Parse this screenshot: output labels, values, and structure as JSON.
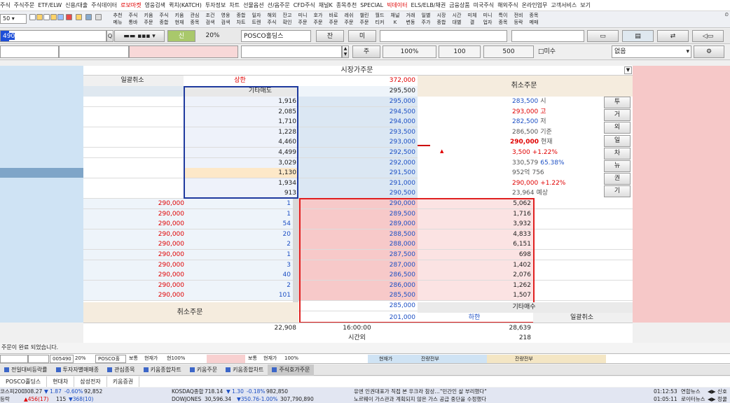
{
  "menu": [
    "주식",
    "주식주문",
    "ETF/ELW",
    "신용/대출",
    "주식데이터",
    "로보마켓",
    "영웅검색",
    "퀵치(KATCH)",
    "투자정보",
    "차트",
    "선물옵션",
    "선/옵주문",
    "CFD주식",
    "채널K",
    "종목추천",
    "SPECIAL",
    "빅데이터",
    "ELS/ELB/채권",
    "금융상품",
    "미국주식",
    "해외주식",
    "온라인업무",
    "고객서비스",
    "보기"
  ],
  "toolbar": [
    {
      "t1": "추천",
      "t2": "메뉴"
    },
    {
      "t1": "주식",
      "t2": "통바"
    },
    {
      "t1": "키움",
      "t2": "주문"
    },
    {
      "t1": "주식",
      "t2": "종합"
    },
    {
      "t1": "키움",
      "t2": "현재"
    },
    {
      "t1": "관심",
      "t2": "종목"
    },
    {
      "t1": "조건",
      "t2": "검색"
    },
    {
      "t1": "영웅",
      "t2": "검색"
    },
    {
      "t1": "종합",
      "t2": "차트"
    },
    {
      "t1": "일자",
      "t2": "트렌"
    },
    {
      "t1": "해외",
      "t2": "주식"
    },
    {
      "t1": "잔고",
      "t2": "확인"
    },
    {
      "t1": "미니",
      "t2": "주문"
    },
    {
      "t1": "호가",
      "t2": "주문"
    },
    {
      "t1": "바로",
      "t2": "주문"
    },
    {
      "t1": "레쉬",
      "t2": "주문"
    },
    {
      "t1": "챌린",
      "t2": "주문"
    },
    {
      "t1": "월드",
      "t2": "티커"
    },
    {
      "t1": "채널",
      "t2": "K"
    },
    {
      "t1": "거래",
      "t2": "변동"
    },
    {
      "t1": "일별",
      "t2": "주가"
    },
    {
      "t1": "시장",
      "t2": "종합"
    },
    {
      "t1": "시간",
      "t2": "대별"
    },
    {
      "t1": "미체",
      "t2": "결"
    },
    {
      "t1": "미니",
      "t2": "업자"
    },
    {
      "t1": "특이",
      "t2": "종목"
    },
    {
      "t1": "전비",
      "t2": "등락"
    },
    {
      "t1": "종목",
      "t2": "메매"
    }
  ],
  "order": {
    "code": "490",
    "credit_label": "신",
    "pct": "20%",
    "stock_name": "POSCO홀딩스",
    "jan_btn": "잔",
    "mi_btn": "미",
    "ju_btn": "주",
    "pct100": "100%",
    "qty100": "100",
    "qty500": "500",
    "misu_label": "□미수",
    "none_select": "없음"
  },
  "header": {
    "market_order": "시장가주문",
    "cancel_all": "일괄취소",
    "upper_limit_label": "상한",
    "upper_limit_price": "372,000",
    "other_sell": "기타매도",
    "other_sell_qty": "295,500",
    "cancel_order": "취소주문",
    "other_buy": "기타매수",
    "lower_limit_label": "하한",
    "lower_limit_price": "201,000",
    "cancel_order2": "취소주문",
    "cancel_all2": "일괄취소",
    "total_sell": "22,908",
    "time": "16:00:00",
    "total_buy": "28,639",
    "after_hours": "시간외",
    "after_hours_qty": "218"
  },
  "asks": [
    {
      "qty": "1,916",
      "price": "295,000"
    },
    {
      "qty": "2,085",
      "price": "294,500"
    },
    {
      "qty": "1,710",
      "price": "294,000"
    },
    {
      "qty": "1,228",
      "price": "293,500"
    },
    {
      "qty": "4,460",
      "price": "293,000"
    },
    {
      "qty": "4,499",
      "price": "292,500"
    },
    {
      "qty": "3,029",
      "price": "292,000"
    },
    {
      "qty": "1,130",
      "price": "291,500"
    },
    {
      "qty": "1,934",
      "price": "291,000"
    },
    {
      "qty": "913",
      "price": "290,500"
    }
  ],
  "bids": [
    {
      "price": "290,000",
      "qty": "5,062"
    },
    {
      "price": "289,500",
      "qty": "1,716"
    },
    {
      "price": "289,000",
      "qty": "3,932"
    },
    {
      "price": "288,500",
      "qty": "4,833"
    },
    {
      "price": "288,000",
      "qty": "6,151"
    },
    {
      "price": "287,500",
      "qty": "698"
    },
    {
      "price": "287,000",
      "qty": "1,402"
    },
    {
      "price": "286,500",
      "qty": "2,076"
    },
    {
      "price": "286,000",
      "qty": "1,262"
    },
    {
      "price": "285,500",
      "qty": "1,507"
    },
    {
      "price": "285,000",
      "qty": ""
    }
  ],
  "trades": [
    {
      "price": "290,000",
      "qty": "1"
    },
    {
      "price": "290,000",
      "qty": "1"
    },
    {
      "price": "290,000",
      "qty": "54"
    },
    {
      "price": "290,000",
      "qty": "20"
    },
    {
      "price": "290,000",
      "qty": "2"
    },
    {
      "price": "290,000",
      "qty": "1"
    },
    {
      "price": "290,000",
      "qty": "3"
    },
    {
      "price": "290,000",
      "qty": "40"
    },
    {
      "price": "290,000",
      "qty": "2"
    },
    {
      "price": "290,000",
      "qty": "101"
    }
  ],
  "info": [
    {
      "a": "283,500",
      "b": "시"
    },
    {
      "a": "293,000",
      "b": "고"
    },
    {
      "a": "282,500",
      "b": "저"
    },
    {
      "a": "286,500",
      "b": "기준"
    },
    {
      "a": "290,000",
      "b": "현재"
    },
    {
      "a": "3,500",
      "b": "+1.22%"
    },
    {
      "a": "330,579",
      "b": "65.38%"
    },
    {
      "a": "952억",
      "b": "756"
    },
    {
      "a": "290,000",
      "b": "+1.22%"
    },
    {
      "a": "23,964",
      "b": "예상"
    }
  ],
  "side_buttons": [
    "투",
    "거",
    "외",
    "일",
    "차",
    "뉴",
    "권",
    "기"
  ],
  "status": "주문이 완료 되었습니다.",
  "bottom": {
    "code": "005490",
    "pct": "20%",
    "name": "POSCO홀",
    "normal": "보통",
    "current": "현재가",
    "rate": "현100%",
    "normal2": "보통",
    "current2": "현재가",
    "rate2": "100%",
    "current3": "현재가",
    "balance": "잔량전부",
    "balance2": "잔량전부"
  },
  "tabs": [
    "전일대비등락률",
    "투자자별매매종",
    "관심종목",
    "키움종합차트",
    "키움주문",
    "키움종합차트",
    "주식호가주문"
  ],
  "watch": [
    "POSCO홀딩스",
    "현대차",
    "삼성전자",
    "키움증권"
  ],
  "ticker1": {
    "a": "코스피200",
    "b": "308.27",
    "c": "▼ 1.87",
    "d": "-0.60%",
    "e": "92,852",
    "f": "KOSDAQ종합",
    "g": "718.14",
    "h": "▼ 1.30",
    "i": "-0.18%",
    "j": "982,850",
    "k": "유엔 인권대표가 직접 본 우크라 참상…\"민간인 살 부리했다\"",
    "l": "01:12:53",
    "m": "연합뉴스",
    "n": "◀▶ 신호"
  },
  "ticker2": {
    "a": "등락",
    "b": "▲456(17)",
    "c": "115",
    "d": "▼368(10)",
    "e": "DOWJONES",
    "f": "30,596.34",
    "g": "▼350.76",
    "h": "-1.00%",
    "i": "307,790,890",
    "j": "노르웨이 가스관과 계획되지 않은 가스 공급 중단을 수정했다",
    "k": "01:05:11",
    "l": "로이터뉴스",
    "m": "◀▶ 정쿨"
  }
}
